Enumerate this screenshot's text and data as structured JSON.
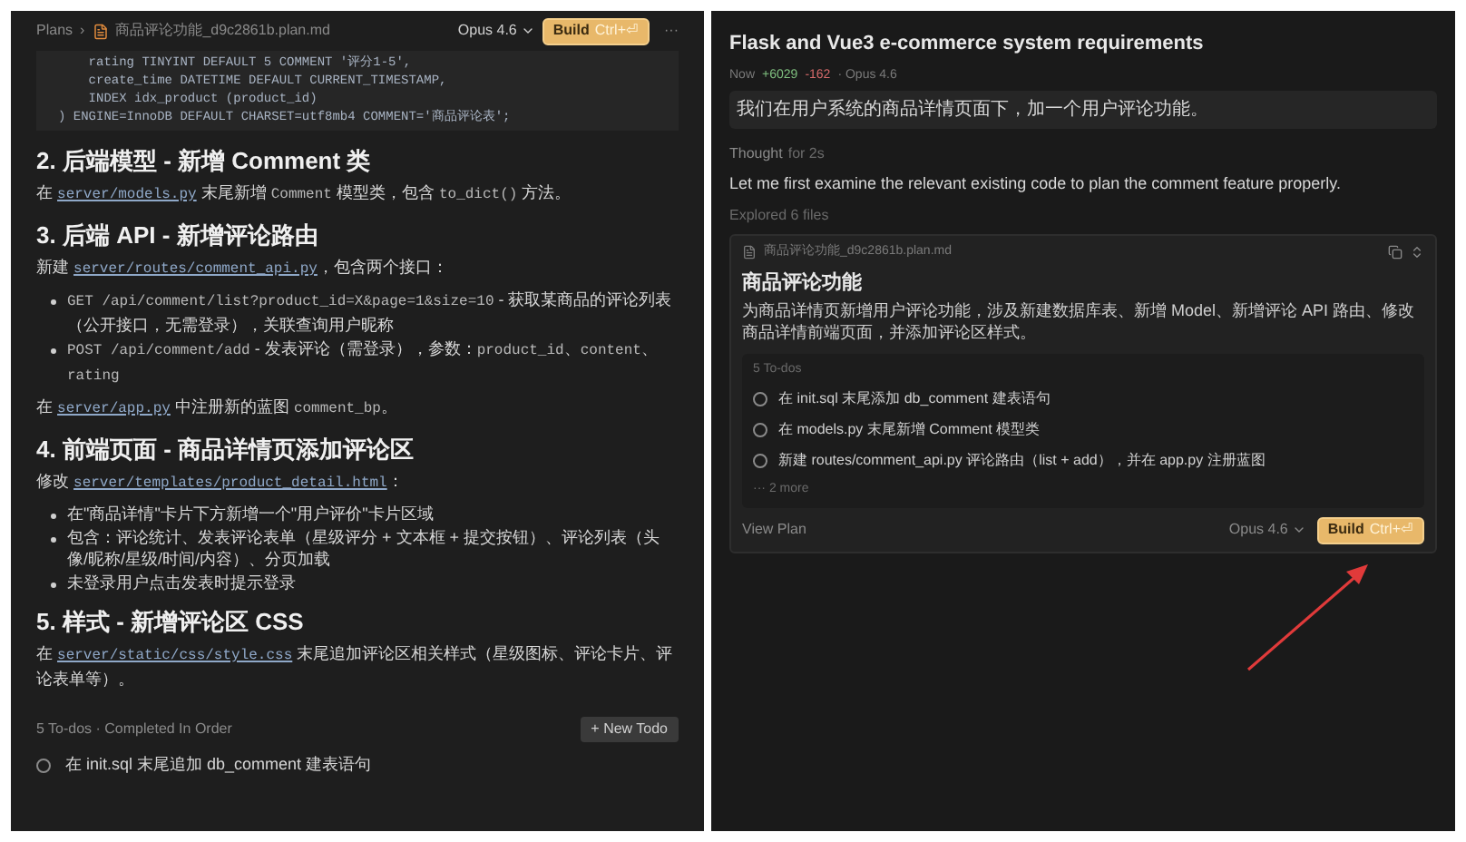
{
  "left": {
    "breadcrumb": {
      "root": "Plans",
      "separator": "›",
      "file": "商品评论功能_d9c2861b.plan.md"
    },
    "model": "Opus 4.6",
    "build": {
      "label": "Build",
      "shortcut": "Ctrl+⏎"
    },
    "more": "···",
    "code_lines": [
      "    rating TINYINT DEFAULT 5 COMMENT '评分1-5',",
      "    create_time DATETIME DEFAULT CURRENT_TIMESTAMP,",
      "    INDEX idx_product (product_id)",
      ") ENGINE=InnoDB DEFAULT CHARSET=utf8mb4 COMMENT='商品评论表';"
    ],
    "sections": [
      {
        "heading": "2. 后端模型 - 新增 Comment 类",
        "blocks": [
          {
            "kind": "paragraph",
            "segments": [
              {
                "kind": "text",
                "text": "在 "
              },
              {
                "kind": "link",
                "text": "server/models.py"
              },
              {
                "kind": "text",
                "text": " 末尾新增 "
              },
              {
                "kind": "code",
                "text": "Comment"
              },
              {
                "kind": "text",
                "text": " 模型类，包含 "
              },
              {
                "kind": "code",
                "text": "to_dict()"
              },
              {
                "kind": "text",
                "text": " 方法。"
              }
            ]
          }
        ]
      },
      {
        "heading": "3. 后端 API - 新增评论路由",
        "blocks": [
          {
            "kind": "paragraph",
            "segments": [
              {
                "kind": "text",
                "text": "新建 "
              },
              {
                "kind": "link",
                "text": "server/routes/comment_api.py"
              },
              {
                "kind": "text",
                "text": "，包含两个接口："
              }
            ]
          },
          {
            "kind": "bullets",
            "items": [
              [
                {
                  "kind": "code",
                  "text": "GET /api/comment/list?product_id=X&page=1&size=10"
                },
                {
                  "kind": "text",
                  "text": " - 获取某商品的评论列表（公开接口，无需登录），关联查询用户昵称"
                }
              ],
              [
                {
                  "kind": "code",
                  "text": "POST /api/comment/add"
                },
                {
                  "kind": "text",
                  "text": " - 发表评论（需登录），参数："
                },
                {
                  "kind": "code",
                  "text": "product_id"
                },
                {
                  "kind": "text",
                  "text": "、"
                },
                {
                  "kind": "code",
                  "text": "content"
                },
                {
                  "kind": "text",
                  "text": "、"
                },
                {
                  "kind": "code",
                  "text": "rating"
                }
              ]
            ]
          },
          {
            "kind": "paragraph",
            "segments": [
              {
                "kind": "text",
                "text": "在 "
              },
              {
                "kind": "link",
                "text": "server/app.py"
              },
              {
                "kind": "text",
                "text": " 中注册新的蓝图 "
              },
              {
                "kind": "code",
                "text": "comment_bp"
              },
              {
                "kind": "text",
                "text": "。"
              }
            ]
          }
        ]
      },
      {
        "heading": "4. 前端页面 - 商品详情页添加评论区",
        "blocks": [
          {
            "kind": "paragraph",
            "segments": [
              {
                "kind": "text",
                "text": "修改 "
              },
              {
                "kind": "link",
                "text": "server/templates/product_detail.html"
              },
              {
                "kind": "text",
                "text": "："
              }
            ]
          },
          {
            "kind": "bullets",
            "items": [
              [
                {
                  "kind": "text",
                  "text": "在\"商品详情\"卡片下方新增一个\"用户评价\"卡片区域"
                }
              ],
              [
                {
                  "kind": "text",
                  "text": "包含：评论统计、发表评论表单（星级评分 + 文本框 + 提交按钮）、评论列表（头像/昵称/星级/时间/内容）、分页加载"
                }
              ],
              [
                {
                  "kind": "text",
                  "text": "未登录用户点击发表时提示登录"
                }
              ]
            ]
          }
        ]
      },
      {
        "heading": "5. 样式 - 新增评论区 CSS",
        "blocks": [
          {
            "kind": "paragraph",
            "segments": [
              {
                "kind": "text",
                "text": "在 "
              },
              {
                "kind": "link",
                "text": "server/static/css/style.css"
              },
              {
                "kind": "text",
                "text": " 末尾追加评论区相关样式（星级图标、评论卡片、评论表单等）。"
              }
            ]
          }
        ]
      }
    ],
    "todos_header": "5 To-dos · Completed In Order",
    "new_todo": "+ New Todo",
    "todos": [
      {
        "text": "在 init.sql 末尾追加 db_comment 建表语句",
        "checked": false
      }
    ]
  },
  "right": {
    "title": "Flask and Vue3 e-commerce system requirements",
    "meta": {
      "time": "Now",
      "added": "+6029",
      "removed": "-162",
      "model": "· Opus 4.6"
    },
    "user_message": "我们在用户系统的商品详情页面下，加一个用户评论功能。",
    "thought": {
      "label": "Thought",
      "duration": "for 2s"
    },
    "reply": "Let me first examine the relevant existing code to plan the comment feature properly.",
    "explored": "Explored 6 files",
    "plan": {
      "file": "商品评论功能_d9c2861b.plan.md",
      "heading": "商品评论功能",
      "description": "为商品详情页新增用户评论功能，涉及新建数据库表、新增 Model、新增评论 API 路由、修改商品详情前端页面，并添加评论区样式。",
      "todos_header": "5 To-dos",
      "todos": [
        {
          "text": "在 init.sql 末尾添加 db_comment 建表语句",
          "checked": false
        },
        {
          "text": "在 models.py 末尾新增 Comment 模型类",
          "checked": false
        },
        {
          "text": "新建 routes/comment_api.py 评论路由（list + add），并在 app.py 注册蓝图",
          "checked": false
        }
      ],
      "more": "··· 2 more",
      "view_plan": "View Plan",
      "model": "Opus 4.6",
      "build": {
        "label": "Build",
        "shortcut": "Ctrl+⏎"
      }
    }
  }
}
